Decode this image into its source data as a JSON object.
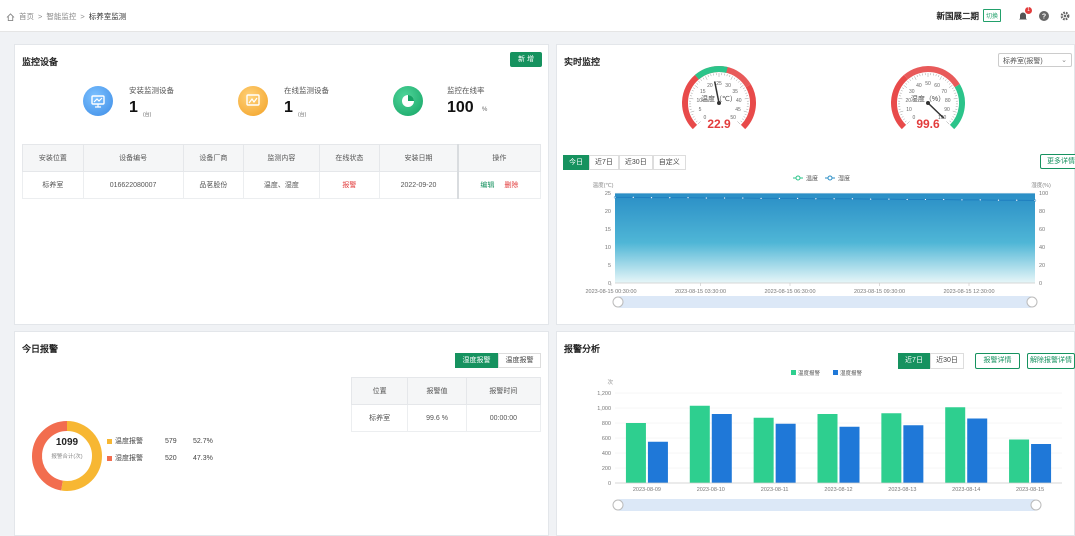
{
  "breadcrumb": {
    "items": [
      "首页",
      "智能监控",
      "标养室监测"
    ]
  },
  "header": {
    "site_name": "新国展二期",
    "site_badge": "切换",
    "notification_count": "1"
  },
  "devices": {
    "title": "监控设备",
    "add_label": "新 增",
    "stats": [
      {
        "label": "安装监测设备",
        "value": "1",
        "unit": "(台)",
        "color": "#4a9bf2"
      },
      {
        "label": "在线监测设备",
        "value": "1",
        "unit": "(台)",
        "color": "#f6a92e"
      },
      {
        "label": "监控在线率",
        "value": "100",
        "unit": "%",
        "color": "#22b573"
      }
    ],
    "columns": [
      "安装位置",
      "设备编号",
      "设备厂商",
      "监测内容",
      "在线状态",
      "安装日期",
      "操作"
    ],
    "rows": [
      {
        "location": "标养室",
        "code": "016622080007",
        "vendor": "品茗股份",
        "content": "温度、湿度",
        "status": "报警",
        "date": "2022-09-20",
        "edit": "编辑",
        "delete": "删除"
      }
    ]
  },
  "realtime": {
    "title": "实时监控",
    "select_value": "标养室(报警)",
    "gauges": [
      {
        "label": "温度（℃）",
        "value": "22.9",
        "max": 50,
        "ticks": [
          "0",
          "5",
          "10",
          "15",
          "20",
          "25",
          "30",
          "35",
          "40",
          "45",
          "50"
        ]
      },
      {
        "label": "湿度（%）",
        "value": "99.6",
        "max": 100,
        "ticks": [
          "0",
          "10",
          "20",
          "30",
          "40",
          "50",
          "60",
          "70",
          "80",
          "90",
          "100"
        ]
      }
    ],
    "tabs": [
      "今日",
      "近7日",
      "近30日",
      "自定义"
    ],
    "more_label": "更多详情",
    "legend": [
      "温度",
      "湿度"
    ],
    "left_axis_title": "温度(℃)",
    "right_axis_title": "湿度(%)"
  },
  "today": {
    "title": "今日报警",
    "tabs": [
      "湿度报警",
      "温度报警"
    ],
    "total": "1099",
    "total_label": "报警合计(次)",
    "breakdown": [
      {
        "name": "温度报警",
        "count": "579",
        "pct": "52.7%",
        "color": "#f7b733"
      },
      {
        "name": "湿度报警",
        "count": "520",
        "pct": "47.3%",
        "color": "#f26d4f"
      }
    ],
    "columns": [
      "位置",
      "报警值",
      "报警时间"
    ],
    "rows": [
      {
        "location": "标养室",
        "value": "99.6 %",
        "time": "00:00:00"
      }
    ]
  },
  "analysis": {
    "title": "报警分析",
    "tabs": [
      "近7日",
      "近30日"
    ],
    "detail_label": "报警详情",
    "release_label": "解除报警详情",
    "y_unit": "次"
  },
  "chart_data": [
    {
      "type": "area",
      "x_ticks": [
        "2023-08-15 00:30:00",
        "2023-08-15 03:30:00",
        "2023-08-15 06:30:00",
        "2023-08-15 09:30:00",
        "2023-08-15 12:30:00"
      ],
      "ylim_left": [
        0,
        25
      ],
      "yticks_left": [
        "0",
        "5",
        "10",
        "15",
        "20",
        "25"
      ],
      "ylim_right": [
        0,
        100
      ],
      "yticks_right": [
        "0",
        "20",
        "40",
        "60",
        "80",
        "100"
      ],
      "series": [
        {
          "name": "温度",
          "axis": "left",
          "values": [
            23.8,
            23.8,
            23.7,
            23.7,
            23.7,
            23.6,
            23.6,
            23.6,
            23.5,
            23.5,
            23.5,
            23.4,
            23.4,
            23.4,
            23.3,
            23.3,
            23.2,
            23.2,
            23.2,
            23.1,
            23.1,
            23.0,
            23.0,
            22.9
          ]
        },
        {
          "name": "湿度",
          "axis": "right",
          "values": [
            99.6,
            99.6,
            99.6,
            99.6,
            99.6,
            99.6,
            99.6,
            99.6,
            99.6,
            99.6,
            99.6,
            99.6,
            99.6,
            99.6,
            99.6,
            99.6,
            99.6,
            99.6,
            99.6,
            99.6,
            99.6,
            99.6,
            99.6,
            99.6
          ]
        }
      ]
    },
    {
      "type": "bar",
      "categories": [
        "2023-08-09",
        "2023-08-10",
        "2023-08-11",
        "2023-08-12",
        "2023-08-13",
        "2023-08-14",
        "2023-08-15"
      ],
      "ylim": [
        0,
        1200
      ],
      "yticks": [
        "0",
        "200",
        "400",
        "600",
        "800",
        "1,000",
        "1,200"
      ],
      "series": [
        {
          "name": "温度报警",
          "color": "#2ecf8f",
          "values": [
            800,
            1030,
            870,
            920,
            930,
            1010,
            580
          ]
        },
        {
          "name": "湿度报警",
          "color": "#1f78d8",
          "values": [
            550,
            920,
            790,
            750,
            770,
            860,
            520
          ]
        }
      ]
    }
  ]
}
